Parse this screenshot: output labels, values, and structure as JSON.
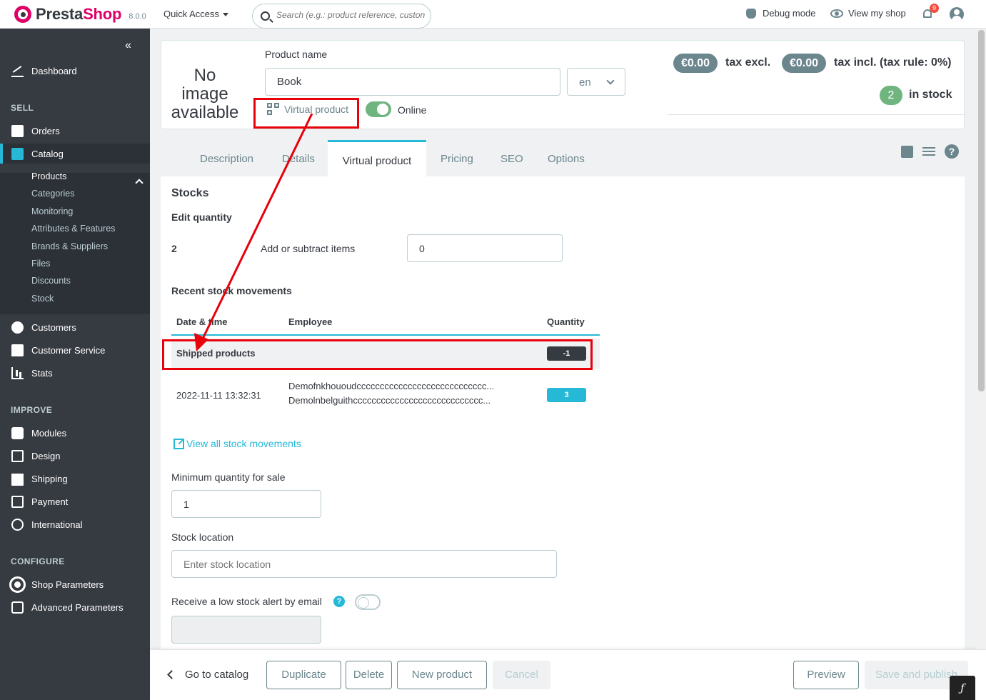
{
  "header": {
    "logo_word1": "Presta",
    "logo_word2": "Shop",
    "version": "8.0.0",
    "quick_access": "Quick Access",
    "search_placeholder": "Search (e.g.: product reference, custon",
    "debug_mode": "Debug mode",
    "view_my_shop": "View my shop",
    "notification_count": "9"
  },
  "sidebar": {
    "collapse_glyph": "«",
    "dashboard": "Dashboard",
    "sections": {
      "sell": "SELL",
      "improve": "IMPROVE",
      "configure": "CONFIGURE"
    },
    "sell_items": [
      "Orders",
      "Catalog"
    ],
    "catalog_sub": [
      "Products",
      "Categories",
      "Monitoring",
      "Attributes & Features",
      "Brands & Suppliers",
      "Files",
      "Discounts",
      "Stock"
    ],
    "sell_items_after": [
      "Customers",
      "Customer Service",
      "Stats"
    ],
    "improve_items": [
      "Modules",
      "Design",
      "Shipping",
      "Payment",
      "International"
    ],
    "configure_items": [
      "Shop Parameters",
      "Advanced Parameters"
    ]
  },
  "product_header": {
    "no_image": "No image available",
    "product_name_label": "Product name",
    "product_name_value": "Book",
    "language": "en",
    "virtual_product": "Virtual product",
    "online_label": "Online",
    "price_excl": "€0.00",
    "price_excl_label": "tax excl.",
    "price_incl": "€0.00",
    "price_incl_label": "tax incl. (tax rule: 0%)",
    "stock_count": "2",
    "stock_label": "in stock"
  },
  "tabs": [
    "Description",
    "Details",
    "Virtual product",
    "Pricing",
    "SEO",
    "Options"
  ],
  "stocks": {
    "title": "Stocks",
    "edit_quantity": "Edit quantity",
    "current_quantity": "2",
    "add_subtract_label": "Add or subtract items",
    "add_subtract_value": "0",
    "recent_movements": "Recent stock movements",
    "columns": [
      "Date & time",
      "Employee",
      "Quantity"
    ],
    "shipped_label": "Shipped products",
    "shipped_quantity": "-1",
    "movement": {
      "date": "2022-11-11 13:32:31",
      "employee_line1": "Demofnkhououdcccccccccccccccccccccccccccc...",
      "employee_line2": "Demolnbelguithcccccccccccccccccccccccccccc...",
      "quantity": "3"
    },
    "view_all": "View all stock movements",
    "min_qty_label": "Minimum quantity for sale",
    "min_qty_value": "1",
    "stock_location_label": "Stock location",
    "stock_location_placeholder": "Enter stock location",
    "low_stock_label": "Receive a low stock alert by email",
    "help_glyph": "?"
  },
  "footer": {
    "go_to_catalog": "Go to catalog",
    "duplicate": "Duplicate",
    "delete": "Delete",
    "new_product": "New product",
    "cancel": "Cancel",
    "preview": "Preview",
    "save_publish": "Save and publish"
  },
  "colors": {
    "accent": "#25b9d7",
    "brand": "#df0067",
    "sidebar_bg": "#363a41",
    "annotation_red": "#e8000b",
    "success": "#70b580"
  }
}
